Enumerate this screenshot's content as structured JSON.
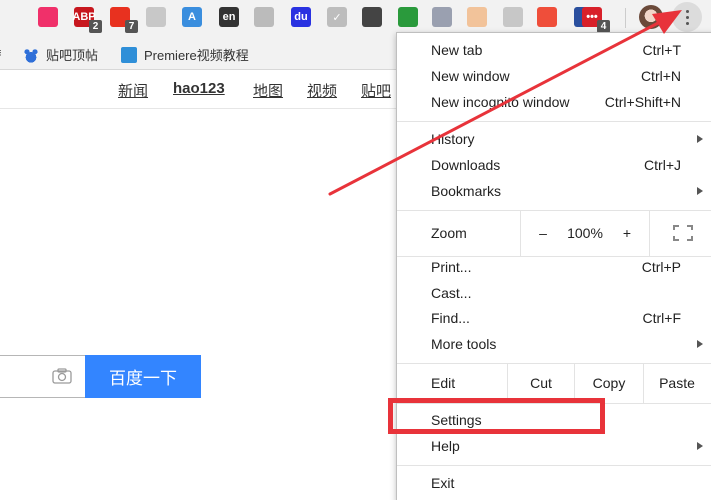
{
  "toolbar": {
    "extensions": [
      {
        "name": "pocket-icon",
        "label": "",
        "color": "#f0306a"
      },
      {
        "name": "adblock-icon",
        "label": "ABP",
        "color": "#c7171e",
        "badge": "2"
      },
      {
        "name": "red-extension-icon",
        "label": "",
        "color": "#e8311f",
        "badge": "7"
      },
      {
        "name": "gray-dot-icon",
        "label": "",
        "color": "#c8c8c8"
      },
      {
        "name": "translate-icon",
        "label": "A",
        "color": "#3a8ede"
      },
      {
        "name": "en-dictionary-icon",
        "label": "en",
        "color": "#333333"
      },
      {
        "name": "figure-icon",
        "label": "",
        "color": "#bbbbbb"
      },
      {
        "name": "baidu-paw-icon",
        "label": "du",
        "color": "#2932e1"
      },
      {
        "name": "check-icon",
        "label": "✓",
        "color": "#bdbdbd"
      },
      {
        "name": "clock-icon",
        "label": "",
        "color": "#444444"
      },
      {
        "name": "download-icon",
        "label": "",
        "color": "#2a9a3c"
      },
      {
        "name": "calligraphy-icon",
        "label": "",
        "color": "#9aa0b0"
      },
      {
        "name": "face-icon",
        "label": "",
        "color": "#f2c39a"
      },
      {
        "name": "music-icon",
        "label": "",
        "color": "#c7c7c7"
      },
      {
        "name": "map-pin-icon",
        "label": "",
        "color": "#ef4e3a"
      },
      {
        "name": "forward-arrow-icon",
        "label": "",
        "color": "#2a4f9e"
      },
      {
        "name": "chat-icon",
        "label": "•••",
        "color": "#d8202a",
        "badge": "4"
      }
    ]
  },
  "bookmarks": [
    {
      "label": "贴吧顶帖",
      "icon": "baidu-paw-icon",
      "color": "#2f6fd8"
    },
    {
      "label": "Premiere视频教程",
      "icon": "premiere-icon",
      "color": "#2f8fd8"
    }
  ],
  "page_nav": [
    {
      "label": "新闻"
    },
    {
      "label": "hao123"
    },
    {
      "label": "地图"
    },
    {
      "label": "视频"
    },
    {
      "label": "贴吧"
    }
  ],
  "search": {
    "button_label": "百度一下",
    "accent": "#3385ff"
  },
  "menu": {
    "new_tab": {
      "label": "New tab",
      "shortcut": "Ctrl+T"
    },
    "new_window": {
      "label": "New window",
      "shortcut": "Ctrl+N"
    },
    "new_incognito": {
      "label": "New incognito window",
      "shortcut": "Ctrl+Shift+N"
    },
    "history": {
      "label": "History"
    },
    "downloads": {
      "label": "Downloads",
      "shortcut": "Ctrl+J"
    },
    "bookmarks": {
      "label": "Bookmarks"
    },
    "zoom": {
      "label": "Zoom",
      "minus": "–",
      "value": "100%",
      "plus": "+"
    },
    "print": {
      "label": "Print...",
      "shortcut": "Ctrl+P"
    },
    "cast": {
      "label": "Cast..."
    },
    "find": {
      "label": "Find...",
      "shortcut": "Ctrl+F"
    },
    "more_tools": {
      "label": "More tools"
    },
    "edit": {
      "label": "Edit",
      "cut": "Cut",
      "copy": "Copy",
      "paste": "Paste"
    },
    "settings": {
      "label": "Settings"
    },
    "help": {
      "label": "Help"
    },
    "exit": {
      "label": "Exit"
    }
  },
  "annotation": {
    "color": "#e8333a"
  }
}
